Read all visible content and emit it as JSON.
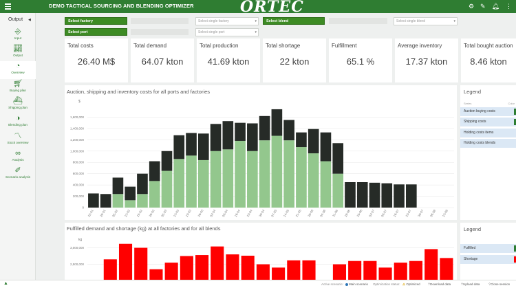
{
  "header": {
    "title": "DEMO TACTICAL SOURCING AND BLENDING OPTIMIZER",
    "logo": "ORTEC",
    "icons": [
      "gear-icon",
      "pencil-icon",
      "bell-icon",
      "more-vert-icon"
    ]
  },
  "sidebar": {
    "section": "Output",
    "items": [
      {
        "label": "Input",
        "icon": "input-icon"
      },
      {
        "label": "Output",
        "icon": "output-icon"
      },
      {
        "label": "Overview",
        "icon": "overview-icon",
        "active": true
      },
      {
        "label": "Buying plan",
        "icon": "cart-icon"
      },
      {
        "label": "Shipping plan",
        "icon": "ship-icon"
      },
      {
        "label": "Blending plan",
        "icon": "blend-icon"
      },
      {
        "label": "Stock overview",
        "icon": "stock-icon"
      },
      {
        "label": "Analysis",
        "icon": "binoculars-icon"
      },
      {
        "label": "Scenario analysis",
        "icon": "scenario-icon"
      }
    ]
  },
  "filters": {
    "factory_btn": "Select factory",
    "factory_select": "Select single factory",
    "blend_btn": "Select blend",
    "blend_select": "Select single blend",
    "port_btn": "Select port",
    "port_select": "Select single port"
  },
  "kpis": [
    {
      "label": "Total costs",
      "value": "26.40 M$"
    },
    {
      "label": "Total demand",
      "value": "64.07 kton"
    },
    {
      "label": "Total production",
      "value": "41.69 kton"
    },
    {
      "label": "Total shortage",
      "value": "22 kton"
    },
    {
      "label": "Fulfillment",
      "value": "65.1 %"
    },
    {
      "label": "Average inventory",
      "value": "17.37 kton"
    },
    {
      "label": "Total bought auction",
      "value": "8.46 kton"
    }
  ],
  "chart1": {
    "title": "Auction, shipping and inventory costs for all ports and factories",
    "legend_title": "Legend",
    "legend_head": [
      "Series",
      "Color"
    ],
    "legend": [
      "Auction buying costs",
      "Shipping costs",
      "Holding costs items",
      "Holding costs blends"
    ]
  },
  "chart2": {
    "title": "Fulfilled demand and shortage (kg) at all factories and for all blends",
    "legend_title": "Legend",
    "legend": [
      "Fulfilled",
      "Shortage"
    ]
  },
  "status": {
    "active_scenario_label": "Active scenario:",
    "active_scenario": "Main scenario",
    "opt_label": "Optimization status:",
    "opt_status": "Optimized",
    "download": "Download data",
    "upload": "Upload data",
    "close": "Close session"
  },
  "colors": {
    "green": "#2f7d32",
    "fulfilled": "#93c78d",
    "dark": "#262b27",
    "shortage": "#ff0000"
  },
  "chart_data": [
    {
      "type": "bar",
      "stacked": true,
      "ylabel": "$",
      "ylim": [
        0,
        1800000
      ],
      "yticks": [
        0,
        200000,
        400000,
        600000,
        800000,
        1000000,
        1200000,
        1400000,
        1600000
      ],
      "ytick_labels": [
        "0",
        "200,000",
        "400,000",
        "600,000",
        "800,000",
        "1,000,000",
        "1,200,000",
        "1,400,000",
        "1,600,000"
      ],
      "categories": [
        "22-01",
        "29-01",
        "05-02",
        "12-02",
        "19-02",
        "26-02",
        "05-03",
        "12-03",
        "19-03",
        "26-03",
        "02-04",
        "09-04",
        "16-04",
        "23-04",
        "30-04",
        "07-05",
        "14-05",
        "21-05",
        "28-05",
        "04-06",
        "11-06",
        "18-06",
        "25-06",
        "02-07",
        "09-07",
        "16-07",
        "23-07",
        "30-07",
        "06-08",
        "13-08"
      ],
      "series": [
        {
          "name": "Shipping costs",
          "color": "#93c78d",
          "values": [
            0,
            0,
            240000,
            130000,
            240000,
            470000,
            650000,
            860000,
            920000,
            840000,
            1000000,
            1030000,
            1180000,
            1000000,
            1190000,
            1270000,
            1190000,
            1070000,
            960000,
            820000,
            600000,
            0,
            0,
            0,
            0,
            0,
            0,
            0,
            0,
            0
          ]
        },
        {
          "name": "Holding costs blends",
          "color": "#262b27",
          "values": [
            250000,
            240000,
            290000,
            240000,
            360000,
            350000,
            350000,
            420000,
            400000,
            470000,
            480000,
            500000,
            320000,
            490000,
            430000,
            470000,
            360000,
            260000,
            430000,
            510000,
            540000,
            450000,
            450000,
            440000,
            430000,
            410000,
            410000,
            0,
            0,
            0
          ]
        }
      ]
    },
    {
      "type": "bar",
      "ylabel": "kg",
      "ytick_labels": [
        "2,000,000",
        "2,500,000",
        "3,000,000"
      ],
      "series": [
        {
          "name": "Shortage",
          "color": "#ff0000",
          "values": [
            0,
            2650000,
            3120000,
            3000000,
            2350000,
            2550000,
            2750000,
            2780000,
            3040000,
            2800000,
            2760000,
            2500000,
            2400000,
            2620000,
            2620000,
            0,
            2500000,
            2600000,
            2600000,
            2400000,
            2550000,
            2600000,
            2960000,
            2690000
          ]
        }
      ]
    }
  ]
}
